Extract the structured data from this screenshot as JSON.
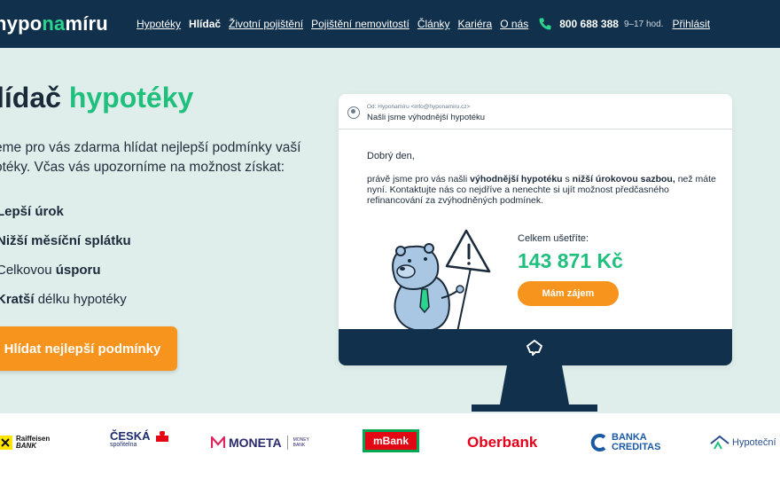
{
  "nav": {
    "logo_main": "hypo",
    "logo_accent": "na",
    "logo_end": "míru",
    "links": [
      "Hypotéky",
      "Hlídač",
      "Životní pojištění",
      "Pojištění nemovitostí",
      "Články",
      "Kariéra",
      "O nás"
    ],
    "active_link": "Hlídač",
    "phone": "800 688 388",
    "hours": "9–17 hod.",
    "login": "Přihlásit"
  },
  "hero": {
    "title_dark": "lídač ",
    "title_accent": "hypotéky",
    "description": "eme pro vás zdarma hlídat nejlepší podmínky vaší otéky. Včas vás upozorníme na možnost získat:",
    "benefits": [
      {
        "bold": "Lepší úrok",
        "rest": ""
      },
      {
        "bold": "Nižší měsíční splátku",
        "rest": ""
      },
      {
        "pre": "Celkovou ",
        "bold": "úsporu"
      },
      {
        "bold": "Kratší",
        "rest": " délku hypotéky"
      }
    ],
    "cta": "Hlídat nejlepší podmínky"
  },
  "email": {
    "from": "Od: Hyponamíru <info@hyponamiru.cz>",
    "subject": "Našli jsme výhodnější hypotéku",
    "greeting": "Dobrý den,",
    "body_1": "právě jsme pro vás našli ",
    "body_b1": "výhodnější hypotéku",
    "body_2": " s ",
    "body_b2": "nižší úrokovou sazbou,",
    "body_3": " než máte nyní. Kontaktujte nás co nejdříve a nenechte si ujít možnost předčasného refinancování za zvýhodněných podmínek.",
    "savings_label": "Celkem ušetříte:",
    "savings_value": "143 871 Kč",
    "button": "Mám zájem"
  },
  "partners": {
    "raiffeisen_1": "Raiffeisen",
    "raiffeisen_2": "BANK",
    "cs_name": "ČESKÁ",
    "cs_sub": "spořitelna",
    "moneta": "MONETA",
    "moneta_small_1": "MONEY",
    "moneta_small_2": "BANK",
    "mbank": "mBank",
    "oberbank": "Oberbank",
    "creditas_1": "BANKA",
    "creditas_2": "CREDITAS",
    "hypotecni": "Hypoteční"
  },
  "colors": {
    "nav_bg": "#10304b",
    "accent_green": "#1fbf7d",
    "cta_orange": "#f7941d",
    "page_bg": "#dfeeea"
  }
}
